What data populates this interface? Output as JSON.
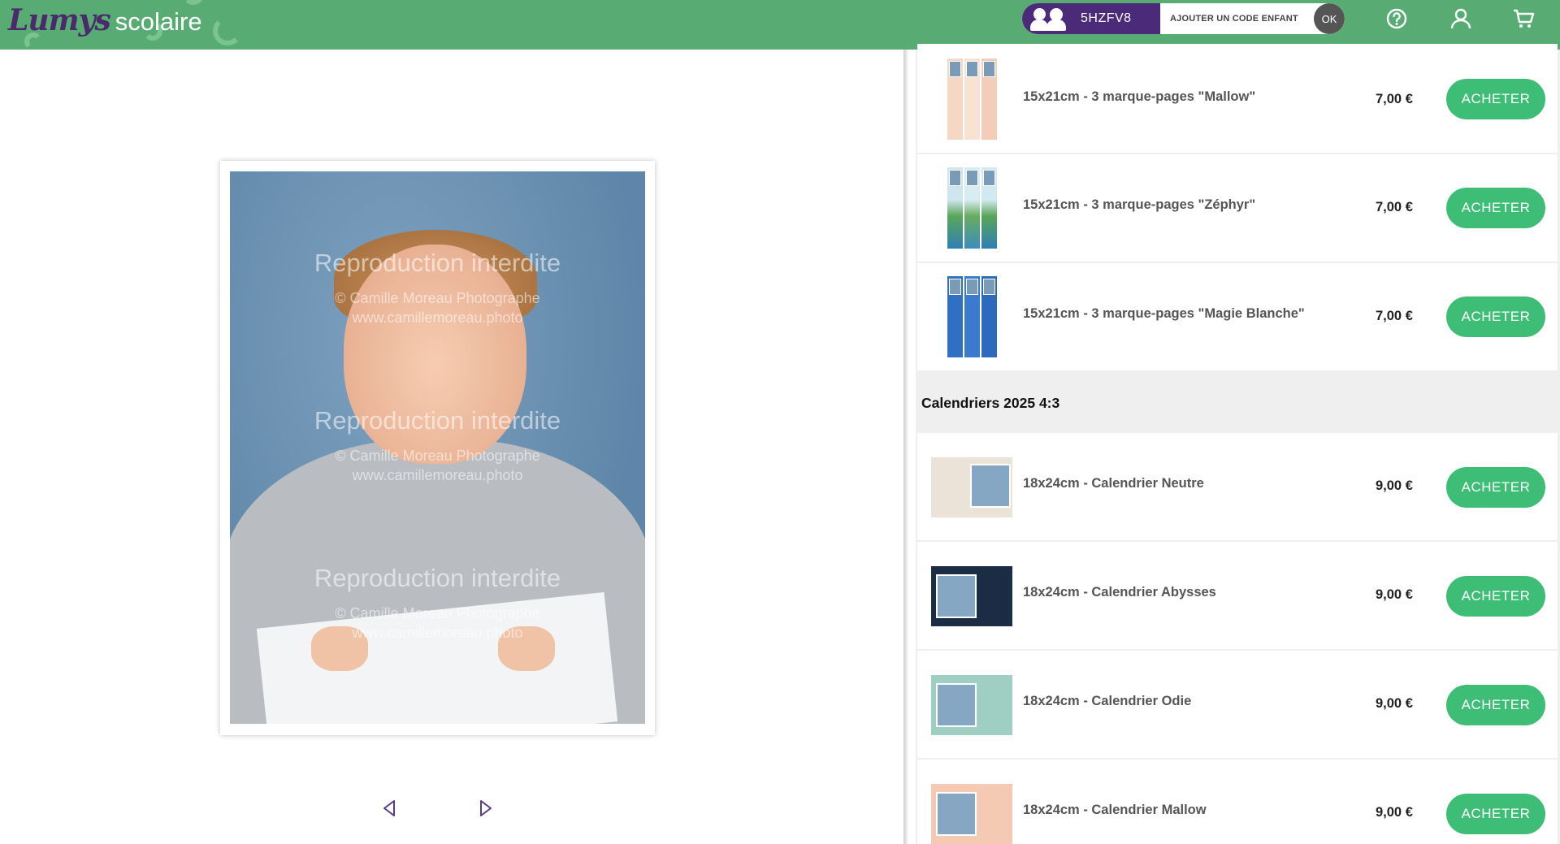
{
  "header": {
    "logo_script": "Lumys",
    "logo_word": "scolaire",
    "child_code": "5HZFV8",
    "add_code_label": "AJOUTER UN CODE ENFANT",
    "ok_label": "OK",
    "colors": {
      "bar": "#58ac73",
      "code_bg": "#4b2a7a"
    },
    "icons": [
      "kids-icon",
      "help-icon",
      "user-icon",
      "cart-icon"
    ]
  },
  "preview": {
    "watermark": {
      "title": "Reproduction interdite",
      "line1": "© Camille Moreau Photographe",
      "line2": "www.camillemoreau.photo"
    },
    "prev_icon": "triangle-left-icon",
    "next_icon": "triangle-right-icon"
  },
  "products": {
    "bookmarks": [
      {
        "label": "15x21cm - 3 marque-pages \"Mallow\"",
        "price": "7,00 €",
        "button": "ACHETER"
      },
      {
        "label": "15x21cm - 3 marque-pages \"Zéphyr\"",
        "price": "7,00 €",
        "button": "ACHETER"
      },
      {
        "label": "15x21cm - 3 marque-pages \"Magie Blanche\"",
        "price": "7,00 €",
        "button": "ACHETER"
      }
    ],
    "calendar_section_title": "Calendriers 2025 4:3",
    "calendars": [
      {
        "label": "18x24cm - Calendrier Neutre",
        "price": "9,00 €",
        "button": "ACHETER"
      },
      {
        "label": "18x24cm - Calendrier Abysses",
        "price": "9,00 €",
        "button": "ACHETER"
      },
      {
        "label": "18x24cm - Calendrier Odie",
        "price": "9,00 €",
        "button": "ACHETER"
      },
      {
        "label": "18x24cm - Calendrier Mallow",
        "price": "9,00 €",
        "button": "ACHETER"
      }
    ],
    "button_color": "#3dbd75"
  }
}
